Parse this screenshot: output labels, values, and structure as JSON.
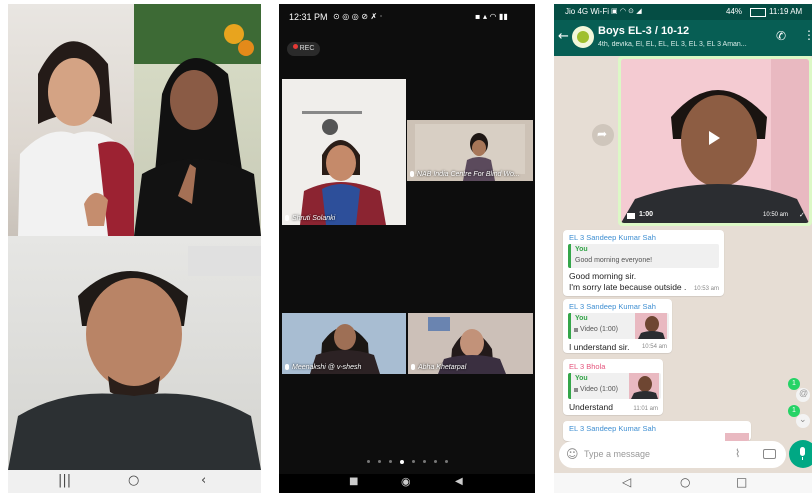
{
  "colors": {
    "whatsapp_header": "#075e54",
    "whatsapp_accent": "#00a884",
    "quote_green": "#35a64a",
    "sender_blue": "#3f8fd2",
    "sender_pink": "#e5557d",
    "rec_red": "#e53935",
    "unread_badge": "#25d366"
  },
  "phone1": {
    "tiles": [
      {
        "name": "woman-white-scarf",
        "icon": "person-photo"
      },
      {
        "name": "woman-black-top",
        "icon": "person-photo"
      },
      {
        "name": "man-dark-jacket",
        "icon": "person-photo"
      }
    ],
    "nav": {
      "recents_icon": "|||",
      "home_icon": "○",
      "back_icon": "‹"
    }
  },
  "phone2": {
    "status_time": "12:31 PM",
    "rec_label": "REC",
    "participants": [
      {
        "name": "Shruti Solanki"
      },
      {
        "name": "NAB India Centre For Blind Wo..."
      },
      {
        "name": "Meenakshi @ v-shesh"
      },
      {
        "name": "Abha Khetarpal"
      }
    ],
    "page_dots": 8,
    "active_dot": 3,
    "nav": {
      "stop_icon": "■",
      "home_icon": "◉",
      "back_icon": "◀"
    }
  },
  "phone3": {
    "status_carrier": "Jio 4G Wi-Fi",
    "status_battery": "44%",
    "status_time": "11:19 AM",
    "chat_title": "Boys EL-3 / 10-12",
    "chat_subtitle": "4th, devika, El, EL, EL, EL 3, EL 3, EL 3  Aman...",
    "video_duration": "1:00",
    "video_time": "10:50 am",
    "messages": [
      {
        "sender": "EL 3 Sandeep Kumar Sah",
        "quote_author": "You",
        "quote_text": "Good morning everyone!",
        "text_line1": "Good morning sir.",
        "text_line2": "I'm sorry late because outside .",
        "time": "10:53 am"
      },
      {
        "sender": "EL 3 Sandeep Kumar Sah",
        "quote_author": "You",
        "quote_text": "Video (1:00)",
        "text_line1": "I understand sir.",
        "time": "10:54 am"
      },
      {
        "sender": "EL 3 Bhola",
        "quote_author": "You",
        "quote_text": "Video (1:00)",
        "text_line1": "Understand",
        "time": "11:01 am"
      },
      {
        "sender": "EL 3 Sandeep Kumar Sah"
      }
    ],
    "badge_1": "1",
    "badge_2": "1",
    "input_placeholder": "Type a message",
    "nav": {
      "back_icon": "◁",
      "home_icon": "○",
      "recents_icon": "□"
    }
  }
}
